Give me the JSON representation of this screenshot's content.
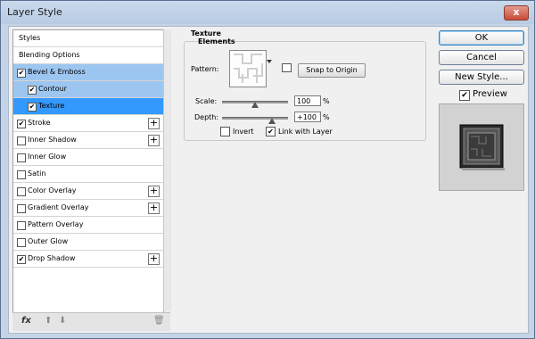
{
  "window": {
    "title": "Layer Style",
    "close_glyph": "x"
  },
  "list": {
    "items": [
      {
        "label": "Styles",
        "checkbox": false,
        "checked": false,
        "plus": false,
        "state": "normal"
      },
      {
        "label": "Blending Options",
        "checkbox": false,
        "checked": false,
        "plus": false,
        "state": "normal"
      },
      {
        "label": "Bevel & Emboss",
        "checkbox": true,
        "checked": true,
        "plus": false,
        "state": "selected-light"
      },
      {
        "label": "Contour",
        "checkbox": true,
        "checked": true,
        "plus": false,
        "state": "selected-light",
        "indent": true
      },
      {
        "label": "Texture",
        "checkbox": true,
        "checked": true,
        "plus": false,
        "state": "selected",
        "indent": true
      },
      {
        "label": "Stroke",
        "checkbox": true,
        "checked": true,
        "plus": true,
        "state": "normal"
      },
      {
        "label": "Inner Shadow",
        "checkbox": true,
        "checked": false,
        "plus": true,
        "state": "normal"
      },
      {
        "label": "Inner Glow",
        "checkbox": true,
        "checked": false,
        "plus": false,
        "state": "normal"
      },
      {
        "label": "Satin",
        "checkbox": true,
        "checked": false,
        "plus": false,
        "state": "normal"
      },
      {
        "label": "Color Overlay",
        "checkbox": true,
        "checked": false,
        "plus": true,
        "state": "normal"
      },
      {
        "label": "Gradient Overlay",
        "checkbox": true,
        "checked": false,
        "plus": true,
        "state": "normal"
      },
      {
        "label": "Pattern Overlay",
        "checkbox": true,
        "checked": false,
        "plus": false,
        "state": "normal"
      },
      {
        "label": "Outer Glow",
        "checkbox": true,
        "checked": false,
        "plus": false,
        "state": "normal"
      },
      {
        "label": "Drop Shadow",
        "checkbox": true,
        "checked": true,
        "plus": true,
        "state": "normal"
      }
    ],
    "footer": {
      "fx_label": "fx",
      "up_glyph": "⬆",
      "down_glyph": "⬇",
      "trash_glyph": "🗑"
    }
  },
  "texture": {
    "group_title": "Texture",
    "group_subtitle": "Elements",
    "pattern_label": "Pattern:",
    "snap_button": "Snap to Origin",
    "scale_label": "Scale:",
    "scale_value": "100",
    "scale_unit": "%",
    "scale_fraction": 0.5,
    "depth_label": "Depth:",
    "depth_value": "+100",
    "depth_unit": "%",
    "depth_fraction": 0.75,
    "invert_label": "Invert",
    "invert_checked": false,
    "link_label": "Link with Layer",
    "link_checked": true
  },
  "buttons": {
    "ok": "OK",
    "cancel": "Cancel",
    "new_style": "New Style...",
    "preview_label": "Preview",
    "preview_checked": true
  },
  "colors": {
    "selected_light": "#9cc6f0",
    "selected_dark": "#3399ff",
    "close_red": "#c94a36"
  },
  "icons": {
    "check_glyph": "✔",
    "plus_glyph": "+"
  }
}
